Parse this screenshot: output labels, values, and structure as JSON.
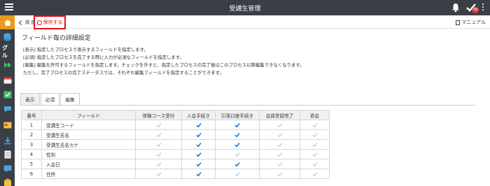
{
  "header": {
    "title": "受講生管理",
    "badge_count": "36"
  },
  "sidebar": {
    "group_label": "グル"
  },
  "toolbar": {
    "back_label": "戻る",
    "save_label": "保存する",
    "manual_label": "マニュアル"
  },
  "page": {
    "title": "フィールド毎の詳細設定",
    "desc": [
      "[表示] 指定したプロセスで表示するフィールドを指定します。",
      "[必須] 指定したプロセスを完了する際に入力が必須なフィールドを指定します。",
      "[編集] 編集を許可するフィールドを指定します。チェックを外すと、指定したプロセスの完了後はこのプロセス以降編集できなくなります。",
      "ただし、完了プロセスの完了ステータスでは、それぞれ編集フィールドを指定することができます。"
    ]
  },
  "tabs": [
    "表示",
    "必須",
    "編集"
  ],
  "table": {
    "headers": [
      "番号",
      "フィールド",
      "体験コース受付",
      "入会手続き",
      "引落口座手続き",
      "会員登録完了",
      "退会"
    ],
    "rows": [
      {
        "no": "1",
        "field": "受講生コード",
        "checks": [
          false,
          true,
          true,
          false,
          false
        ]
      },
      {
        "no": "2",
        "field": "受講生氏名",
        "checks": [
          false,
          true,
          true,
          false,
          false
        ]
      },
      {
        "no": "3",
        "field": "受講生氏名カナ",
        "checks": [
          false,
          true,
          true,
          false,
          false
        ]
      },
      {
        "no": "4",
        "field": "性別",
        "checks": [
          false,
          true,
          false,
          false,
          false
        ]
      },
      {
        "no": "5",
        "field": "入会日",
        "checks": [
          false,
          true,
          true,
          false,
          false
        ]
      },
      {
        "no": "6",
        "field": "住所",
        "checks": [
          false,
          true,
          false,
          false,
          false
        ]
      }
    ]
  },
  "icons": {
    "topbar": [
      "menu-icon",
      "bell-icon",
      "checkmark-icon",
      "more-vertical-icon"
    ],
    "sidebar": [
      "home-icon",
      "database-icon",
      "group-label",
      "arrow-right-icon",
      "calendar-icon",
      "check-calendar-icon",
      "chat-icon",
      "id-card-icon",
      "download-icon",
      "document-icon",
      "comment-icon",
      "building-icon"
    ]
  },
  "colors": {
    "accent": "#e89b1e",
    "check_on": "#1a6fc9",
    "check_off": "#c2c2c2",
    "highlight": "#e0101a",
    "topbar": "#3a3f46"
  }
}
